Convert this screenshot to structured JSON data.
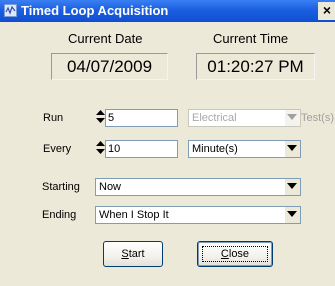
{
  "window": {
    "title": "Timed Loop Acquisition",
    "close_glyph": "×"
  },
  "current_date": {
    "caption": "Current Date",
    "value": "04/07/2009"
  },
  "current_time": {
    "caption": "Current Time",
    "value": "01:20:27 PM"
  },
  "run": {
    "label": "Run",
    "value": "5",
    "type_value": "Electrical",
    "type_enabled": false,
    "suffix": "Test(s)"
  },
  "every": {
    "label": "Every",
    "value": "10",
    "unit": "Minute(s)"
  },
  "starting": {
    "label": "Starting",
    "value": "Now"
  },
  "ending": {
    "label": "Ending",
    "value": "When I Stop It"
  },
  "buttons": {
    "start": {
      "mnemonic": "S",
      "rest": "tart"
    },
    "close": {
      "mnemonic": "C",
      "rest": "lose"
    }
  },
  "icons": {
    "app": "labview-icon",
    "close": "close-icon",
    "spinner": "spinner-icon",
    "dropdown": "dropdown-arrow-icon"
  },
  "colors": {
    "titlebar": "#1b5fe0",
    "dialog_bg": "#ece9d8",
    "disabled_text": "#a8a8a8"
  }
}
